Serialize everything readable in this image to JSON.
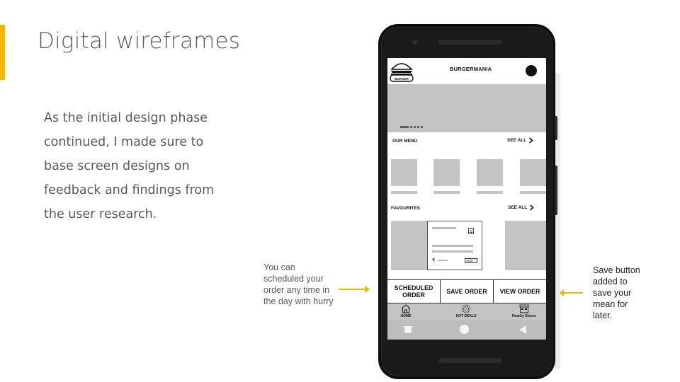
{
  "slide": {
    "title": "Digital wireframes",
    "body": "As the initial design phase continued, I made sure to base screen designs on feedback and findings from the user research.",
    "accent_color": "#f5b700"
  },
  "notes": {
    "left": "You can scheduled your order any time in the day with hurry",
    "right": "Save button added to save your mean for later."
  },
  "app": {
    "logo_text": "BURGER",
    "brand": "BURGERMANIA",
    "our_menu": {
      "label": "OUR MENU",
      "see_all": "SEE ALL"
    },
    "favourites": {
      "label": "FAVOURITES",
      "see_all": "SEE ALL",
      "currency": "₹",
      "add_label": "ADD +"
    },
    "actions": [
      "SCHEDULED ORDER",
      "SAVE ORDER",
      "VIEW ORDER"
    ],
    "tabs": [
      {
        "label": "HOME",
        "icon": "home-icon"
      },
      {
        "label": "HOT DEALS",
        "icon": "hot-deals-badge-icon"
      },
      {
        "label": "Nearby Stores",
        "icon": "store-icon"
      }
    ],
    "nav": [
      "recent-apps-icon",
      "home-circle-icon",
      "back-triangle-icon"
    ]
  }
}
